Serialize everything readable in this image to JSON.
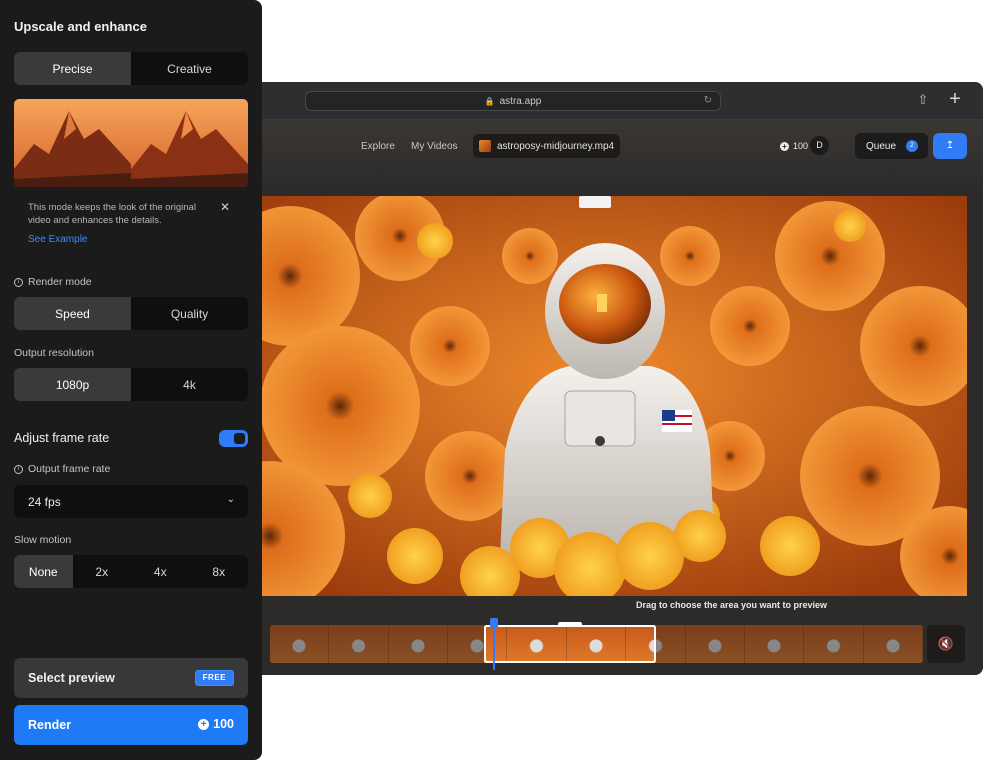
{
  "browser": {
    "url": "astra.app",
    "share_icon": "share-icon",
    "new_tab_icon": "plus-icon"
  },
  "app": {
    "nav": [
      "Explore",
      "My Videos"
    ],
    "file_name": "astroposy-midjourney.mp4",
    "credits": "100",
    "avatar_initial": "D",
    "queue_label": "Queue",
    "queue_count": "2",
    "hint": "Drag to choose the area you want to preview"
  },
  "panel": {
    "title": "Upscale and enhance",
    "mode_options": [
      "Precise",
      "Creative"
    ],
    "mode_selected": "Precise",
    "info_text": "This mode keeps the look of the original video and enhances the details.",
    "info_link": "See Example",
    "render_mode_label": "Render mode",
    "render_mode_options": [
      "Speed",
      "Quality"
    ],
    "render_mode_selected": "Speed",
    "resolution_label": "Output resolution",
    "resolution_options": [
      "1080p",
      "4k"
    ],
    "resolution_selected": "1080p",
    "adjust_frame_rate_label": "Adjust frame rate",
    "adjust_frame_rate_on": true,
    "frame_rate_label": "Output frame rate",
    "frame_rate_value": "24 fps",
    "slow_motion_label": "Slow motion",
    "slow_motion_options": [
      "None",
      "2x",
      "4x",
      "8x"
    ],
    "slow_motion_selected": "None",
    "select_preview_label": "Select preview",
    "free_badge": "FREE",
    "render_label": "Render",
    "render_cost": "100"
  },
  "colors": {
    "accent": "#2f7cf6",
    "panel_bg": "#1b1b1c"
  }
}
